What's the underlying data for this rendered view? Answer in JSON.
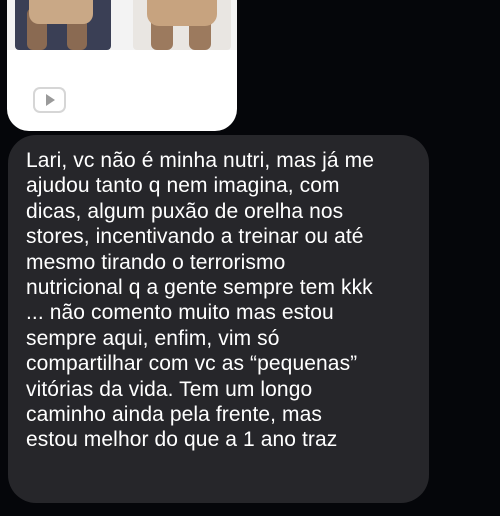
{
  "message": {
    "lines": [
      "Lari, vc não é minha nutri, mas já me",
      "ajudou tanto q nem imagina, com",
      "dicas, algum puxão de orelha nos",
      "stores, incentivando a treinar ou até",
      "mesmo tirando o terrorismo",
      "nutricional q a gente sempre tem kkk",
      "... não comento muito mas estou",
      "sempre aqui, enfim, vim só",
      "compartilhar com vc as “pequenas”",
      "vitórias da vida. Tem um longo",
      "caminho ainda pela frente, mas",
      "estou melhor do que a 1 ano traz"
    ]
  },
  "media": {
    "icon": "play-video-icon"
  },
  "colors": {
    "background": "#05060a",
    "bubble": "#26262a",
    "text": "#ffffff",
    "card": "#ffffff"
  }
}
